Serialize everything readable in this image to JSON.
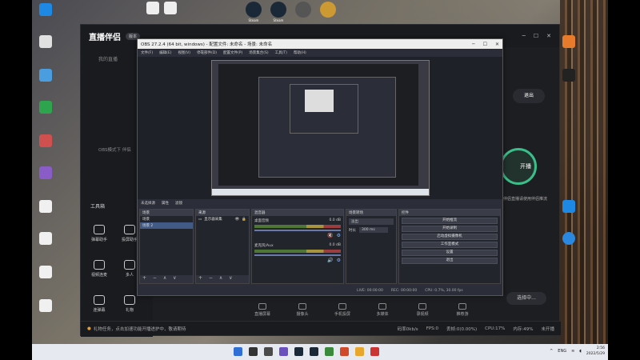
{
  "desktop": {
    "top_icons": [
      {
        "label": "Steam",
        "color": "#1b2838"
      },
      {
        "label": "Steam",
        "color": "#1b2838"
      },
      {
        "label": "",
        "color": "#555555"
      },
      {
        "label": "",
        "color": "#c93"
      }
    ],
    "left_icons": [
      {
        "label": "",
        "color": "#1e88e5"
      },
      {
        "label": "",
        "color": "#e0e0e0"
      },
      {
        "label": "",
        "color": "#2ea44f"
      },
      {
        "label": "",
        "color": "#8a5cc8"
      },
      {
        "label": "",
        "color": "#f0f0f0"
      },
      {
        "label": "",
        "color": "#f0f0f0"
      },
      {
        "label": "",
        "color": "#f0f0f0"
      },
      {
        "label": "",
        "color": "#f0f0f0"
      }
    ]
  },
  "zbj": {
    "logo": "直播伴侣",
    "version": "版本",
    "win_buttons": [
      "─",
      "☐",
      "✕"
    ],
    "tab_label": "我的直播",
    "obs_mode_note": "OBS模式下 伴侣",
    "tools_title": "工具箱",
    "tools": [
      {
        "label": "弹幕助手"
      },
      {
        "label": "投屏助手"
      },
      {
        "label": "连弹幕"
      },
      {
        "label": "视频连麦"
      },
      {
        "label": "多人"
      },
      {
        "label": "礼物"
      }
    ],
    "logout_label": "退出",
    "start_label": "开播",
    "right_note": "伴侣直播请使用伴侣推流",
    "bottom_tools": [
      "直播屏幕",
      "摄像头",
      "手机投屏",
      "多媒体",
      "录视频",
      "推荐游"
    ],
    "pick_label": "选择中...",
    "status_left": "礼物任务，点击加速功能开播进护中，敬请期待",
    "status_stats": [
      "码率0kb/s",
      "FPS:0",
      "丢帧:0(0.00%)",
      "CPU:17%",
      "内存:49%",
      "未开播"
    ]
  },
  "obs": {
    "title": "OBS 27.2.4 (64 bit, windows) - 配置文件: 未命名 - 场景: 未命名",
    "win_buttons": [
      "─",
      "☐",
      "✕"
    ],
    "menu": [
      "文件(F)",
      "编辑(E)",
      "视图(V)",
      "停靠部件(D)",
      "配置文件(P)",
      "场景集合(S)",
      "工具(T)",
      "帮助(H)"
    ],
    "dock_bar": [
      "未选择源",
      "属性",
      "滤镜"
    ],
    "scenes": {
      "title": "场景",
      "items": [
        "场景",
        "场景 2"
      ]
    },
    "sources": {
      "title": "来源",
      "items": [
        "显示器采集"
      ]
    },
    "mixer": {
      "title": "混音器",
      "tracks": [
        {
          "name": "桌面音频",
          "db": "0.0 dB"
        },
        {
          "name": "麦克风/Aux",
          "db": "0.0 dB"
        }
      ]
    },
    "transitions": {
      "title": "场景转场",
      "type": "淡出",
      "duration_label": "时长",
      "duration": "300 ms"
    },
    "controls": {
      "title": "控件",
      "buttons": [
        "开始推流",
        "开始录制",
        "启动虚拟摄像机",
        "工作室模式",
        "设置",
        "退出"
      ]
    },
    "dock_foot": "+ − ∧ ∨",
    "status": [
      "LIVE: 00:00:00",
      "REC: 00:00:00",
      "CPU: 0.7%, 30.00 fps"
    ]
  },
  "taskbar": {
    "icons": [
      "#2f6fd6",
      "#333333",
      "#4a4a4a",
      "#6b4fbf",
      "#1b2838",
      "#1b2838",
      "#3b8a3b",
      "#d04a2a",
      "#e8a72c",
      "#c33"
    ],
    "lang": "ENG",
    "time": "2:56",
    "date": "2022/5/29"
  }
}
